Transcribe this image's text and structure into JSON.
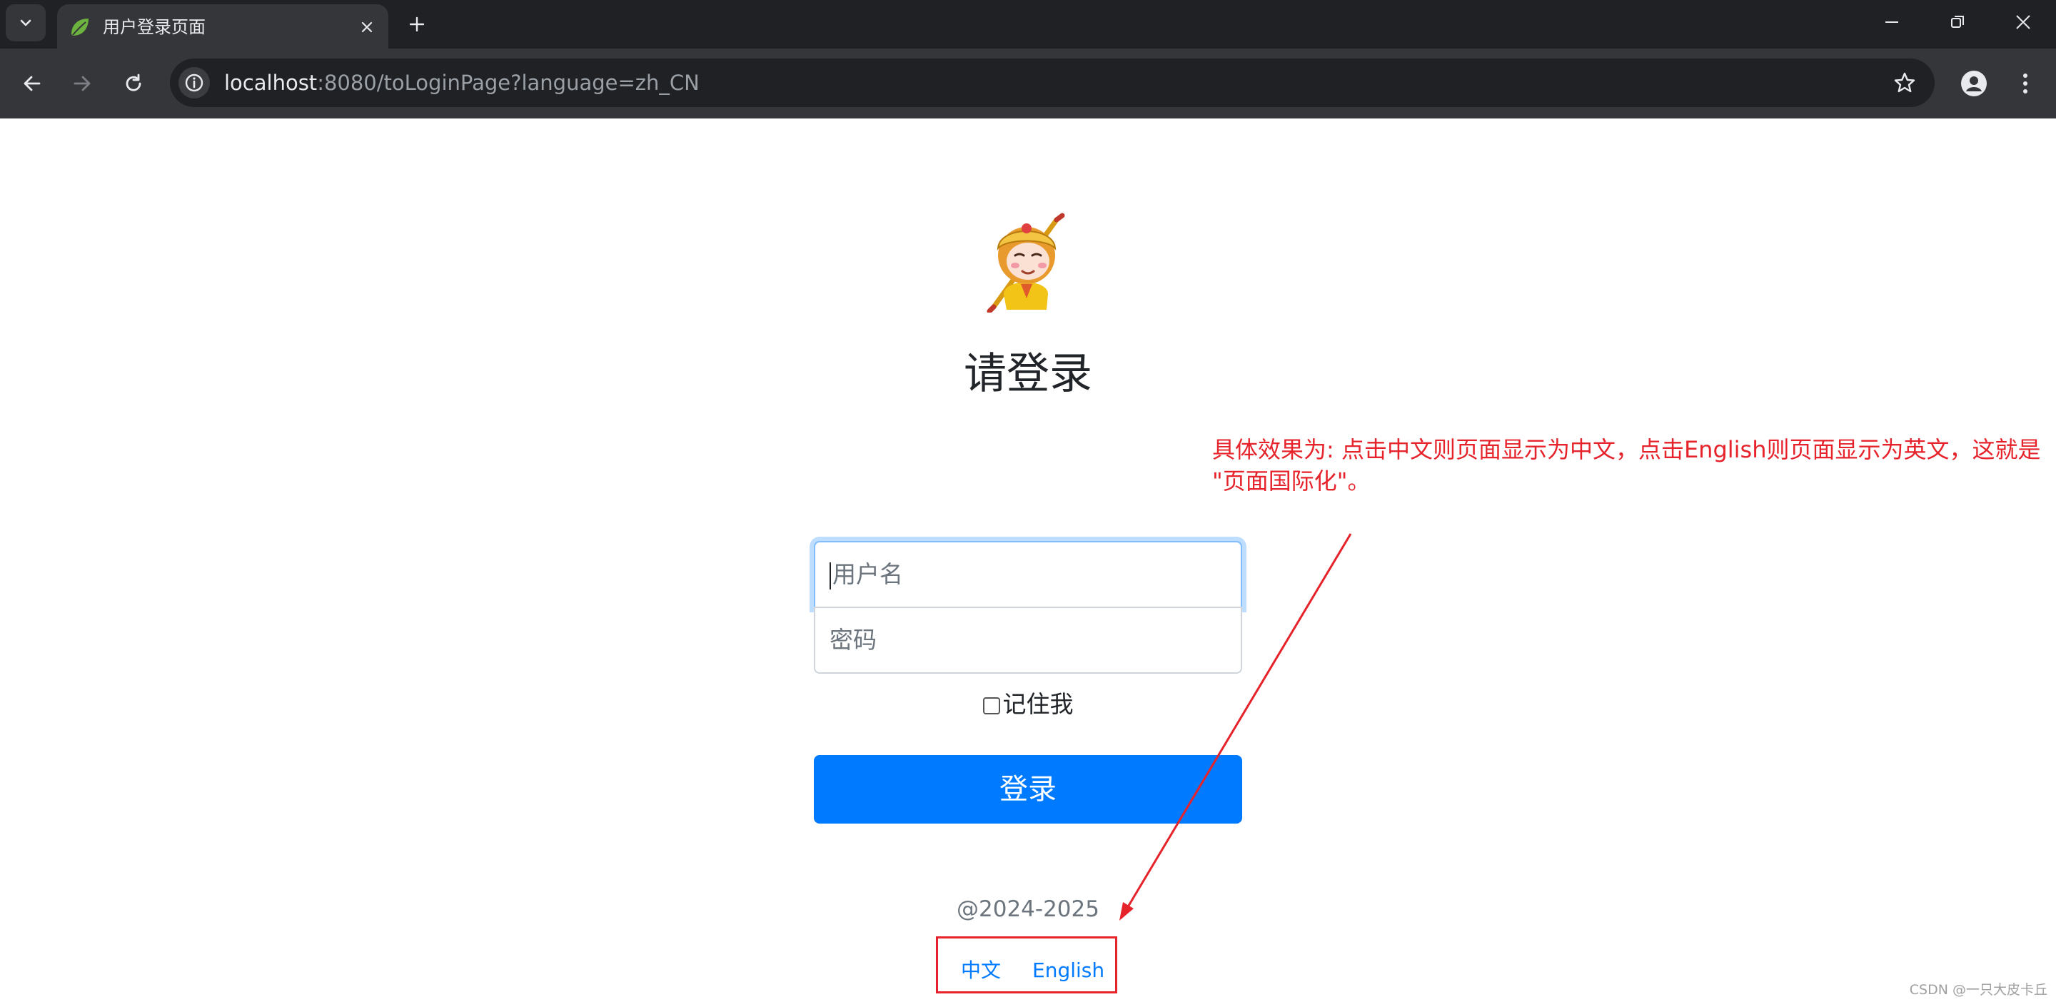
{
  "browser": {
    "tab_title": "用户登录页面",
    "url_host": "localhost",
    "url_rest": ":8080/toLoginPage?language=zh_CN",
    "icons": {
      "tab_list": "chevron-down-icon",
      "favicon": "spring-leaf-icon",
      "tab_close": "close-icon",
      "new_tab": "plus-icon",
      "minimize": "minimize-icon",
      "restore": "restore-icon",
      "close_window": "close-icon",
      "back": "back-arrow-icon",
      "forward": "forward-arrow-icon",
      "reload": "reload-icon",
      "site_info": "info-icon",
      "bookmark": "star-icon",
      "profile": "profile-icon",
      "menu": "more-vertical-icon"
    }
  },
  "login": {
    "heading": "请登录",
    "username_placeholder": "用户名",
    "password_placeholder": "密码",
    "remember_label": "记住我",
    "submit_label": "登录",
    "copyright": "@2024-2025",
    "lang_zh": "中文",
    "lang_en": "English"
  },
  "annotation": {
    "line1": "具体效果为: 点击中文则页面显示为中文，点击English则页面显示为英文，这就是",
    "line2": "\"页面国际化\"。"
  },
  "watermark": "CSDN @一只大皮卡丘",
  "colors": {
    "primary": "#007bff",
    "annotation_red": "#e6232b",
    "chrome_dark": "#202124",
    "chrome_toolbar": "#35363a"
  }
}
